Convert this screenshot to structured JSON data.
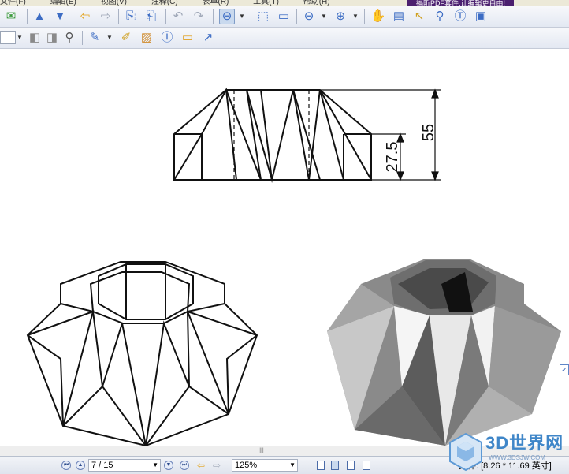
{
  "menubar": {
    "items": [
      "文件(F)",
      "编辑(E)",
      "视图(V)",
      "注释(C)",
      "表单(R)",
      "工具(T)",
      "帮助(H)"
    ],
    "promo": "福昕PDF套件,让编辑更自由!"
  },
  "toolbar": {
    "row1_icons": [
      "email-icon",
      "page-up-icon",
      "page-down-icon",
      "back-icon",
      "forward-icon",
      "extract-page-icon",
      "insert-page-icon",
      "undo-icon",
      "redo-icon",
      "zoom-out-tool-icon",
      "zoom-dropdown-icon",
      "fit-page-icon",
      "fit-width-icon",
      "zoom-minus-icon",
      "zoom-plus-icon",
      "hand-tool-icon",
      "text-select-icon",
      "select-tool-icon",
      "find-icon",
      "typewriter-icon",
      "snapshot-icon"
    ],
    "row2_icons": [
      "audio-icon",
      "video-icon",
      "search-icon",
      "note-icon",
      "pen-icon",
      "highlight-icon",
      "textbox-icon",
      "comment-icon",
      "arrow-icon"
    ]
  },
  "status": {
    "page_display": "7 / 15",
    "zoom": "125%",
    "doc_size": "文件: [8.26 * 11.69 英寸]"
  },
  "drawing": {
    "dim_total": "55",
    "dim_half": "27.5"
  },
  "watermark": {
    "title": "3D世界网",
    "url": "WWW.3DSJW.COM"
  },
  "colors": {
    "toolbar_bg": "#e3e8f2",
    "accent": "#3f86c8",
    "promo_bg": "#4b1f6f"
  }
}
